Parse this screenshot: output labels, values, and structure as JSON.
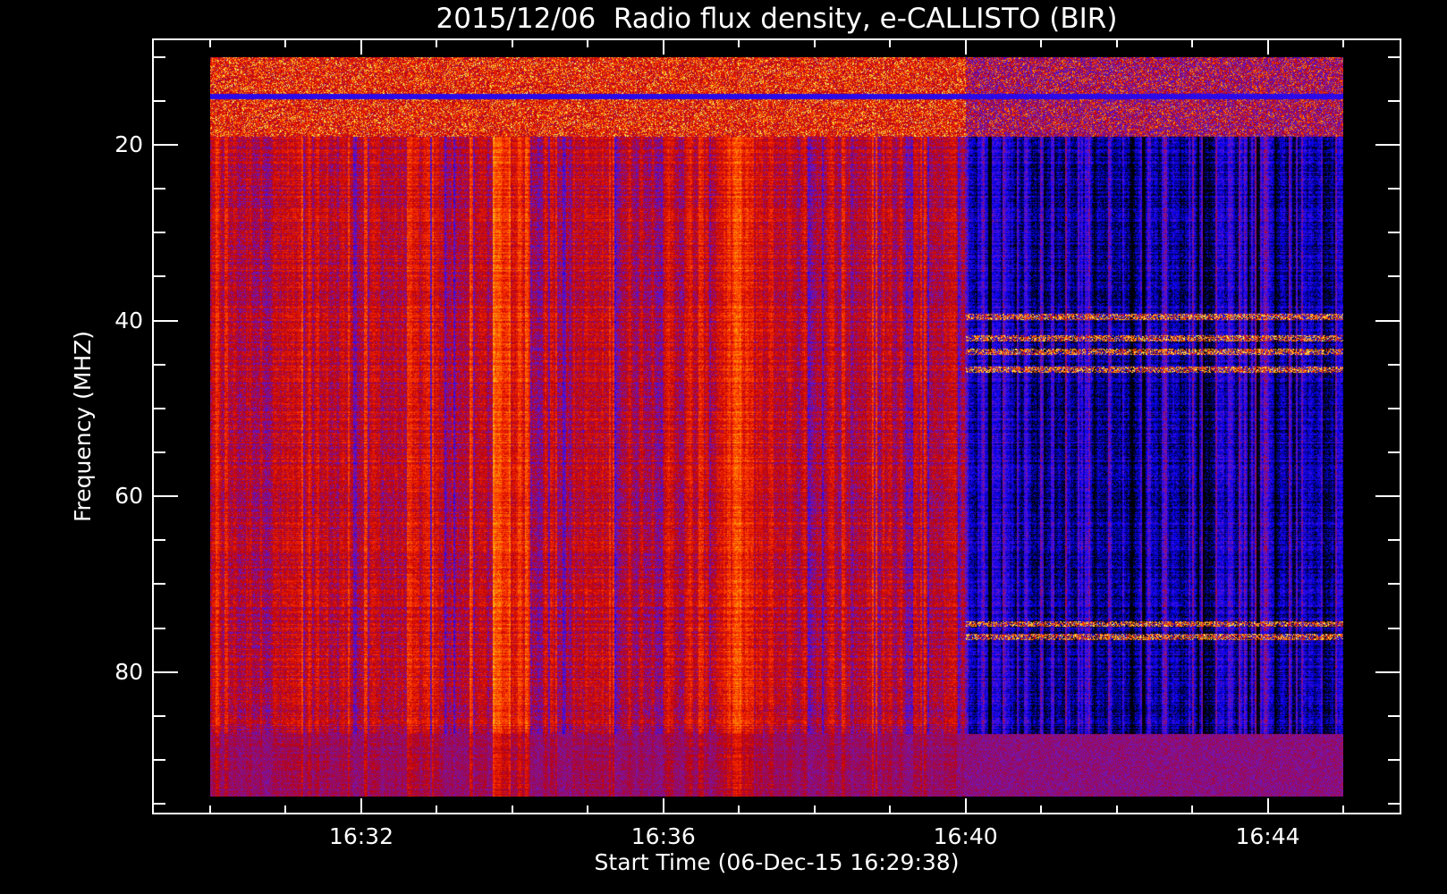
{
  "chart_data": {
    "type": "heatmap",
    "title": "2015/12/06  Radio flux density, e-CALLISTO (BIR)",
    "xlabel": "Start Time (06-Dec-15 16:29:38)",
    "ylabel": "Frequency (MHZ)",
    "x_unit": "minutes after 16:00 UT",
    "xlim": [
      29.23,
      45.77
    ],
    "ylim": [
      96.2,
      7.9
    ],
    "y_inverted": true,
    "data_time_range": [
      30.0,
      45.0
    ],
    "data_freq_range": [
      10.0,
      94.2
    ],
    "x_major_ticks": [
      {
        "value": 32,
        "label": "16:32"
      },
      {
        "value": 36,
        "label": "16:36"
      },
      {
        "value": 40,
        "label": "16:40"
      },
      {
        "value": 44,
        "label": "16:44"
      }
    ],
    "x_minor_tick_step": 1,
    "y_major_ticks": [
      {
        "value": 20,
        "label": "20"
      },
      {
        "value": 40,
        "label": "40"
      },
      {
        "value": 60,
        "label": "60"
      },
      {
        "value": 80,
        "label": "80"
      }
    ],
    "y_minor_tick_step": 5,
    "colormap": [
      "#000000",
      "#0000ff",
      "#6a18c8",
      "#c00000",
      "#ff3000",
      "#ff9a00",
      "#ffff60",
      "#ffffff"
    ],
    "features": [
      {
        "description": "broadband red emission columns",
        "time_range": [
          30.0,
          40.0
        ],
        "level": 0.6
      },
      {
        "description": "quiet period with blue stripes",
        "time_range": [
          40.0,
          45.0
        ],
        "level": 0.15
      },
      {
        "description": "bright interference band",
        "freq_range": [
          10.0,
          19.0
        ],
        "level": 0.75
      },
      {
        "description": "narrowband interference lines",
        "freqs": [
          39.5,
          42,
          43.5,
          45.5,
          74.5,
          76
        ],
        "time_range": [
          40.0,
          45.0
        ]
      },
      {
        "description": "purple lower band",
        "freq_range": [
          87.0,
          94.2
        ],
        "level": 0.35
      }
    ]
  }
}
